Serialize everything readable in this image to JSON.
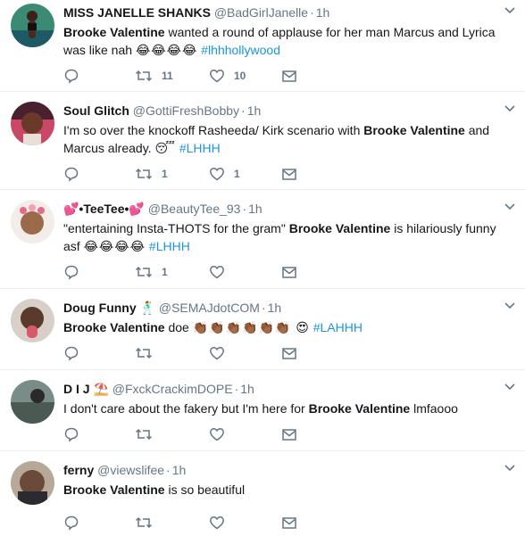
{
  "tweets": [
    {
      "fullname": "MISS JANELLE SHANKS",
      "handle": "@BadGirlJanelle",
      "time": "1h",
      "text_bold": "Brooke Valentine",
      "text_rest": " wanted a round of applause for her man Marcus and Lyrica was like nah ",
      "emoji": "😂😂😂😂",
      "hashtag": "#lhhhollywood",
      "retweets": "11",
      "likes": "10",
      "avatar_color": "#2a6b5e"
    },
    {
      "fullname": "Soul Glitch",
      "handle": "@GottiFreshBobby",
      "time": "1h",
      "text_before": "I'm so over the knockoff Rasheeda/ Kirk scenario with ",
      "text_bold": "Brooke Valentine",
      "text_after": " and Marcus already. ",
      "emoji": "😴",
      "hashtag": "#LHHH",
      "retweets": "1",
      "likes": "1",
      "avatar_color": "#7a1f3d"
    },
    {
      "fullname": "💕•TeeTee•💕",
      "handle": "@BeautyTee_93",
      "time": "1h",
      "text_before": "\"entertaining Insta-THOTS for the gram\" ",
      "text_bold": "Brooke Valentine",
      "text_after": " is hilariously funny asf ",
      "emoji": "😂😂😂😂",
      "hashtag": "#LHHH",
      "retweets": "1",
      "likes": "",
      "avatar_color": "#c9a58a"
    },
    {
      "fullname": "Doug Funny 🕺",
      "handle": "@SEMAJdotCOM",
      "time": "1h",
      "text_bold": "Brooke Valentine",
      "text_after": " doe ",
      "emoji": "👏🏾👏🏾👏🏾👏🏾👏🏾👏🏾 😍",
      "hashtag": "#LAHHH",
      "retweets": "",
      "likes": "",
      "avatar_color": "#8c7a70"
    },
    {
      "fullname": "D I J ⛱️",
      "handle": "@FxckCrackimDOPE",
      "time": "1h",
      "text_before": "I don't care about the fakery but I'm here for ",
      "text_bold": "Brooke Valentine",
      "text_after": " lmfaooo",
      "retweets": "",
      "likes": "",
      "avatar_color": "#5a6f6a"
    },
    {
      "fullname": "ferny",
      "handle": "@viewslifee",
      "time": "1h",
      "text_bold": "Brooke Valentine",
      "text_after": " is so beautiful",
      "retweets": "",
      "likes": "",
      "avatar_color": "#6e5a4c"
    }
  ],
  "icons": {
    "reply": "reply-icon",
    "retweet": "retweet-icon",
    "like": "heart-icon",
    "dm": "envelope-icon",
    "more": "chevron-down-icon"
  },
  "colors": {
    "link": "#1b95e0",
    "muted": "#657786",
    "divider": "#e6ecf0"
  }
}
